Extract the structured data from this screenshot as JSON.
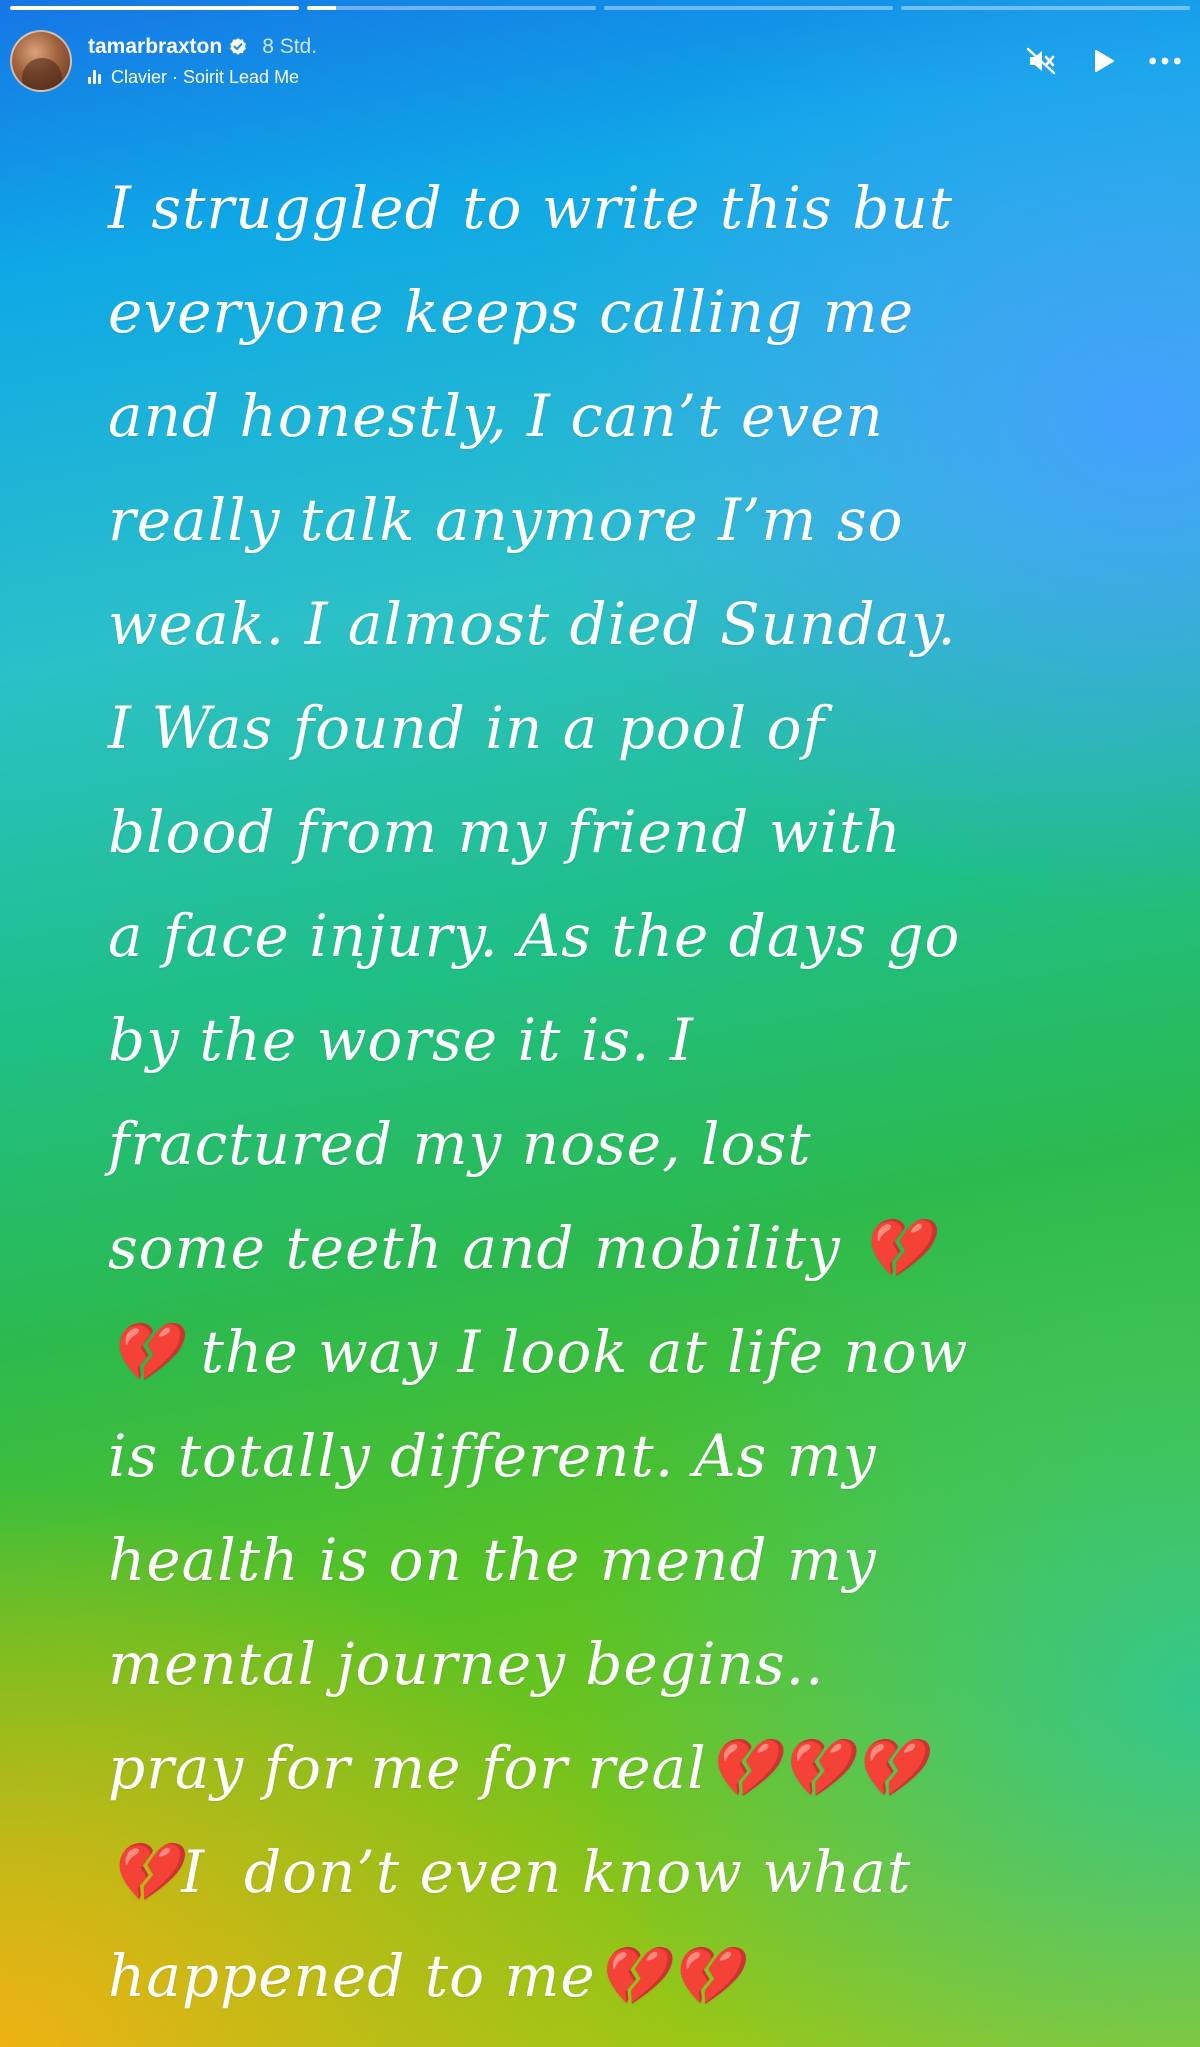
{
  "story": {
    "progress": [
      {
        "fill_fraction": 1.0
      },
      {
        "fill_fraction": 0.1
      },
      {
        "fill_fraction": 0
      },
      {
        "fill_fraction": 0
      }
    ],
    "header": {
      "username": "tamarbraxton",
      "verified_icon": "verified-badge-icon",
      "time_ago": "8 Std.",
      "music": {
        "icon": "music-bars-icon",
        "label": "Clavier · Soirit Lead Me"
      },
      "controls": {
        "mute_icon": "speaker-muted-icon",
        "play_icon": "play-icon",
        "more_icon": "more-options-icon"
      }
    },
    "text": "I struggled to write this but\neveryone keeps calling me\nand honestly, I can’t even\nreally talk anymore I’m so\nweak. I almost died Sunday.\nI Was found in a pool of\nblood from my friend with\na face injury. As the days go\nby the worse it is. I\nfractured my nose, lost\nsome teeth and mobility 💔\n💔 the way I look at life now\nis totally different. As my\nhealth is on the mend my\nmental journey begins..\npray for me for real💔💔💔\n💔I  don’t even know what\nhappened to me💔💔",
    "colors": {
      "top": "#1676e6",
      "middle": "#2cba4e",
      "bottom_left": "#eeb214",
      "text": "#ffffff"
    }
  }
}
